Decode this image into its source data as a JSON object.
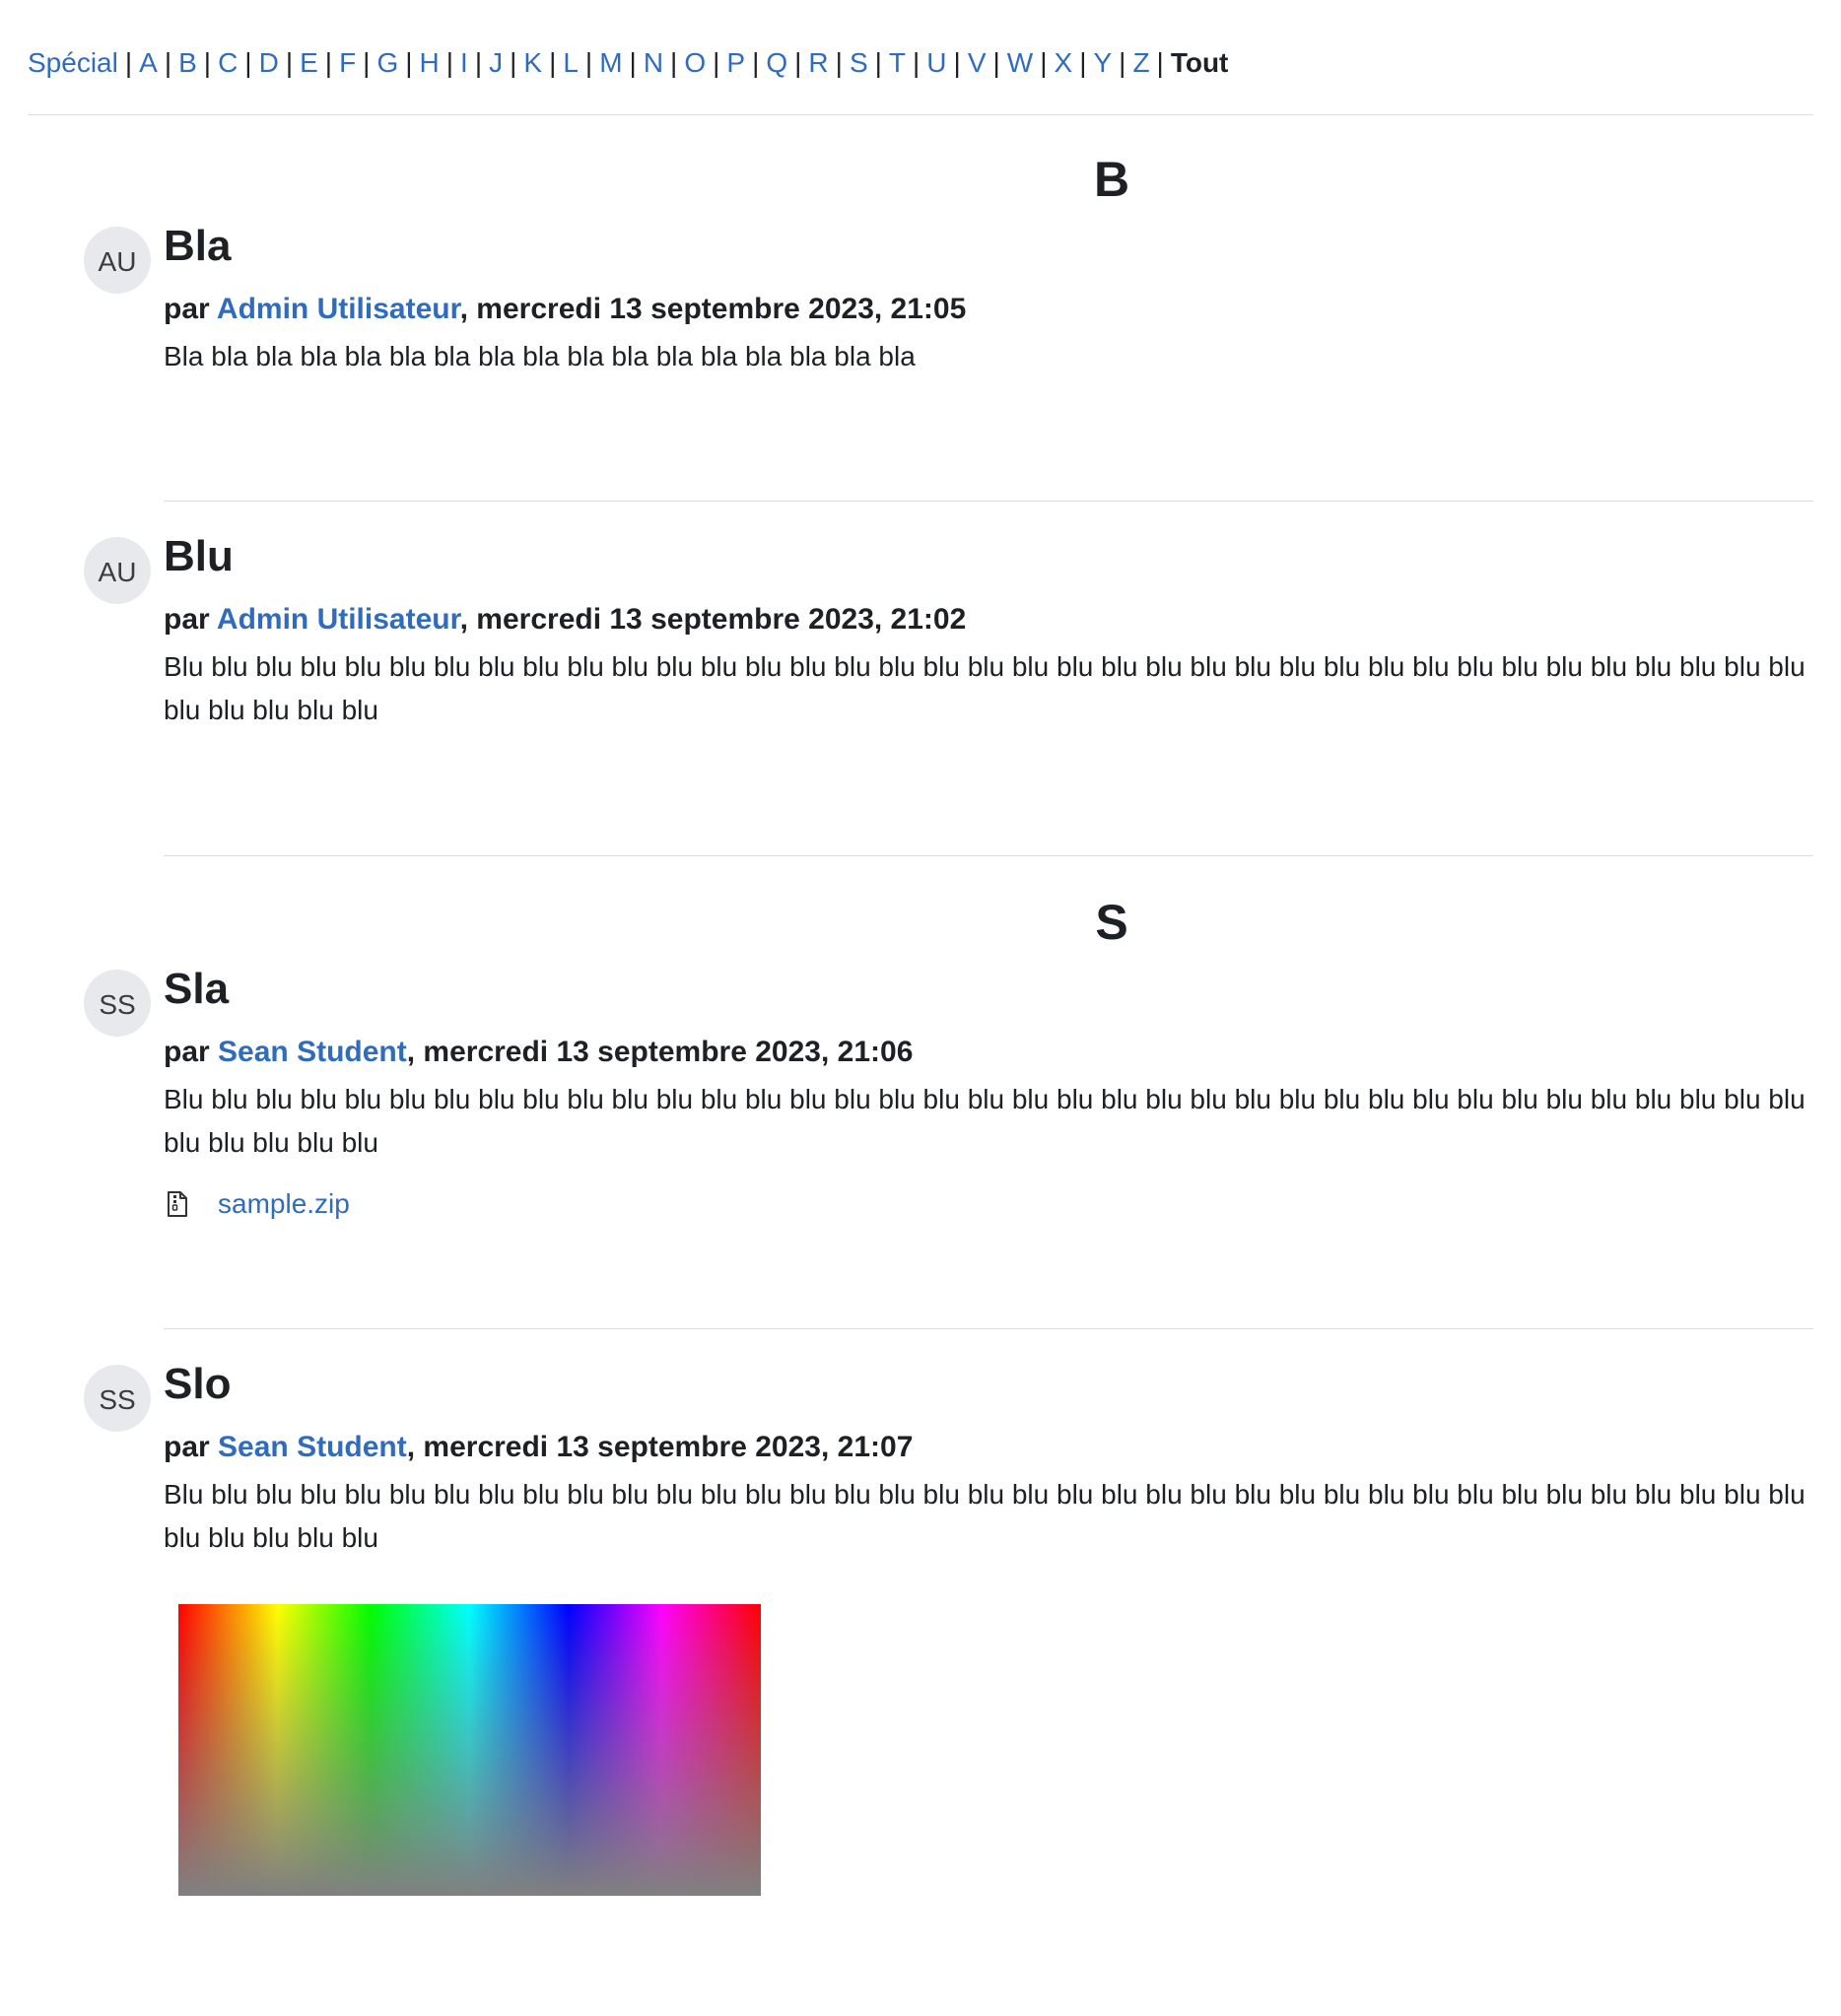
{
  "nav": {
    "letters": [
      "Spécial",
      "A",
      "B",
      "C",
      "D",
      "E",
      "F",
      "G",
      "H",
      "I",
      "J",
      "K",
      "L",
      "M",
      "N",
      "O",
      "P",
      "Q",
      "R",
      "S",
      "T",
      "U",
      "V",
      "W",
      "X",
      "Y",
      "Z"
    ],
    "current": "Tout",
    "separator": "|"
  },
  "sections": [
    {
      "letter": "B",
      "entries": [
        {
          "avatar": "AU",
          "title": "Bla",
          "by_prefix": "par ",
          "author": "Admin Utilisateur",
          "date": ", mercredi 13 septembre 2023, 21:05",
          "text": "Bla bla bla bla bla bla bla bla bla bla bla bla bla bla bla bla bla"
        },
        {
          "avatar": "AU",
          "title": "Blu",
          "by_prefix": "par ",
          "author": "Admin Utilisateur",
          "date": ", mercredi 13 septembre 2023, 21:02",
          "text": "Blu blu blu blu blu blu blu blu blu blu blu blu blu blu blu blu blu blu blu blu blu blu blu blu blu blu blu blu blu blu blu blu blu blu blu blu blu blu blu blu blu blu"
        }
      ]
    },
    {
      "letter": "S",
      "entries": [
        {
          "avatar": "SS",
          "title": "Sla",
          "by_prefix": "par ",
          "author": "Sean Student",
          "date": ", mercredi 13 septembre 2023, 21:06",
          "text": "Blu blu blu blu blu blu blu blu blu blu blu blu blu blu blu blu blu blu blu blu blu blu blu blu blu blu blu blu blu blu blu blu blu blu blu blu blu blu blu blu blu blu",
          "attachment": "sample.zip"
        },
        {
          "avatar": "SS",
          "title": "Slo",
          "by_prefix": "par ",
          "author": "Sean Student",
          "date": ", mercredi 13 septembre 2023, 21:07",
          "text": "Blu blu blu blu blu blu blu blu blu blu blu blu blu blu blu blu blu blu blu blu blu blu blu blu blu blu blu blu blu blu blu blu blu blu blu blu blu blu blu blu blu blu"
        }
      ]
    }
  ],
  "colors": {
    "link": "#2f6cbd",
    "text": "#1d2125",
    "divider": "#dcdfe3",
    "avatar_bg": "#e8e9ec"
  }
}
